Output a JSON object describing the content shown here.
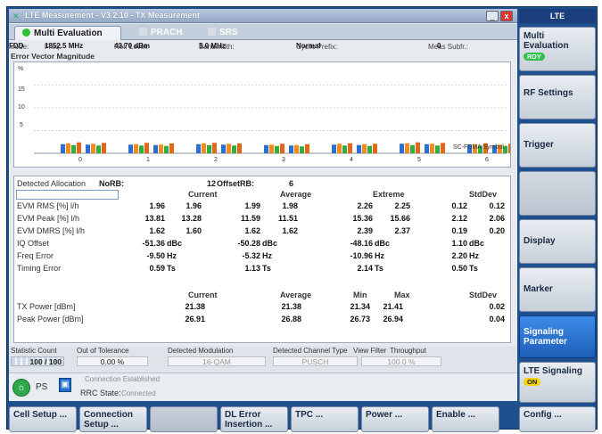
{
  "window": {
    "title": "LTE Measurement - V3.2.10 - TX Measurement",
    "min_label": "_",
    "close_label": "x"
  },
  "tabs": [
    {
      "label": "Multi Evaluation",
      "active": true
    },
    {
      "label": "PRACH",
      "active": false
    },
    {
      "label": "SRS",
      "active": false
    }
  ],
  "info": {
    "mode_label": "Mode:",
    "mode": "FDD",
    "freq_label": "Freq:",
    "freq": "1852.5 MHz",
    "ref_label": "Ref. Level:",
    "ref": "43.70 dBm",
    "bw_label": "Bandwidth:",
    "bw": "5.0 MHz",
    "cp_label": "Cyclic Prefix:",
    "cp": "Normal",
    "subfr_label": "Meas Subfr.:",
    "subfr": "0"
  },
  "evm_title": "Error Vector Magnitude",
  "chart_data": {
    "type": "bar",
    "ylabel": "%",
    "ylim": [
      0,
      18
    ],
    "yticks": [
      5,
      10,
      15
    ],
    "x_ticks": [
      "0",
      "1",
      "2",
      "3",
      "4",
      "5",
      "6"
    ],
    "annotation": "SC-FDMA Symbol",
    "series": [
      {
        "color": "#2b6fd1",
        "values": [
          2.0,
          1.9,
          2.0,
          1.8,
          1.9,
          2.1,
          1.9
        ]
      },
      {
        "color": "#f28a1e",
        "values": [
          2.2,
          2.0,
          2.2,
          1.9,
          2.1,
          2.2,
          2.0
        ]
      },
      {
        "color": "#2fae3f",
        "values": [
          1.8,
          1.7,
          1.8,
          1.6,
          1.7,
          1.8,
          1.7
        ]
      },
      {
        "color": "#e2671c",
        "values": [
          2.4,
          2.3,
          2.3,
          2.1,
          2.2,
          2.4,
          2.2
        ]
      }
    ]
  },
  "table": {
    "alloc_label": "Detected Allocation",
    "norb_label": "NoRB:",
    "norb": "12",
    "offset_label": "OffsetRB:",
    "offset": "6",
    "headers": [
      "Current",
      "Average",
      "Extreme",
      "StdDev"
    ],
    "rows": [
      {
        "label": "EVM RMS [%] l/h",
        "values": [
          "1.96",
          "1.96",
          "1.99",
          "1.98",
          "2.26",
          "2.25",
          "0.12",
          "0.12"
        ]
      },
      {
        "label": "EVM Peak [%] l/h",
        "values": [
          "13.81",
          "13.28",
          "11.59",
          "11.51",
          "15.36",
          "15.66",
          "2.12",
          "2.06"
        ]
      },
      {
        "label": "EVM DMRS [%] l/h",
        "values": [
          "1.62",
          "1.60",
          "1.62",
          "1.62",
          "2.39",
          "2.37",
          "0.19",
          "0.20"
        ]
      }
    ],
    "single_rows": [
      {
        "label": "IQ Offset",
        "values": [
          "-51.36",
          "-50.28",
          "-48.16",
          "1.10"
        ],
        "unit": "dBc"
      },
      {
        "label": "Freq Error",
        "values": [
          "-9.50",
          "-5.32",
          "-10.96",
          "2.20"
        ],
        "unit": "Hz"
      },
      {
        "label": "Timing Error",
        "values": [
          "0.59",
          "1.13",
          "2.14",
          "0.50"
        ],
        "unit": "Ts"
      }
    ],
    "power_headers": [
      "Current",
      "Average",
      "Min",
      "Max",
      "StdDev"
    ],
    "power_rows": [
      {
        "label": "TX Power [dBm]",
        "values": [
          "21.38",
          "21.38",
          "21.34",
          "21.41",
          "0.02"
        ]
      },
      {
        "label": "Peak Power [dBm]",
        "values": [
          "26.91",
          "26.88",
          "26.73",
          "26.94",
          "0.04"
        ]
      }
    ]
  },
  "bottom": {
    "stat_label": "Statistic Count",
    "stat_value": "100 / 100",
    "oot_label": "Out of Tolerance",
    "oot_value": "0.00 %",
    "mod_label": "Detected Modulation",
    "mod_value": "16-QAM",
    "chtype_label": "Detected Channel Type",
    "chtype_value": "PUSCH",
    "vf_label": "View Filter",
    "vf_value": "",
    "tp_label": "Throughput",
    "tp_value": "100.0 %",
    "ps_label": "PS",
    "conn_status": "Connection Established",
    "rrc_label": "RRC State:",
    "rrc_value": "Connected"
  },
  "side": {
    "header": "LTE",
    "keys": [
      {
        "label": "Multi Evaluation",
        "badge": "RDY"
      },
      {
        "label": "RF Settings"
      },
      {
        "label": "Trigger"
      },
      {
        "label": ""
      },
      {
        "label": "Display"
      },
      {
        "label": "Marker"
      },
      {
        "label": "Signaling Parameter"
      },
      {
        "label": "LTE Signaling",
        "badge": "ON"
      }
    ]
  },
  "softkeys": [
    "Cell Setup ...",
    "Connection Setup ...",
    "",
    "DL Error Insertion ...",
    "TPC ...",
    "Power ...",
    "Enable ...",
    "Config ..."
  ]
}
